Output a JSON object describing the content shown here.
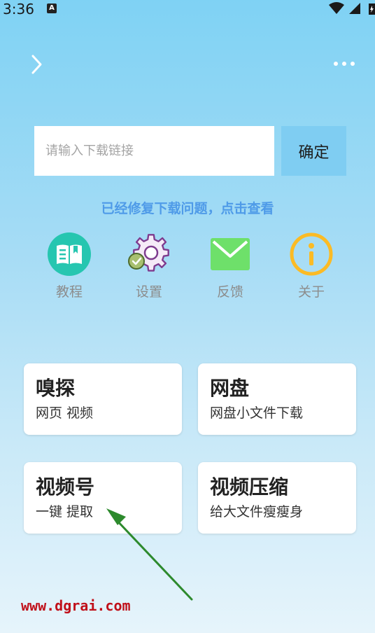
{
  "status_bar": {
    "time": "3:36",
    "notification_glyph": "A",
    "icons": [
      "wifi-icon",
      "signal-icon",
      "battery-icon"
    ]
  },
  "nav": {
    "back_icon": "chevron-right-icon",
    "menu_icon": "more-horizontal-icon"
  },
  "search": {
    "placeholder": "请输入下载链接",
    "value": "",
    "confirm_label": "确定"
  },
  "notice": "已经修复下载问题，点击查看",
  "shortcuts": [
    {
      "label": "教程",
      "icon": "book-icon",
      "color": "#26c6b0"
    },
    {
      "label": "设置",
      "icon": "gear-icon",
      "color": "#7e3b8e"
    },
    {
      "label": "反馈",
      "icon": "mail-icon",
      "color": "#6ee06a"
    },
    {
      "label": "关于",
      "icon": "info-icon",
      "color": "#fbbb25"
    }
  ],
  "cards": [
    {
      "title": "嗅探",
      "subtitle": "网页 视频"
    },
    {
      "title": "网盘",
      "subtitle": "网盘小文件下载"
    },
    {
      "title": "视频号",
      "subtitle": "一键 提取"
    },
    {
      "title": "视频压缩",
      "subtitle": "给大文件瘦瘦身"
    }
  ],
  "overlay": {
    "watermark": "www.dgrai.com",
    "arrow_icon": "arrow-pointer-icon",
    "arrow_color": "#2d8a2d"
  },
  "colors": {
    "accent": "#7fcdf2",
    "notice": "#4f9be8"
  }
}
